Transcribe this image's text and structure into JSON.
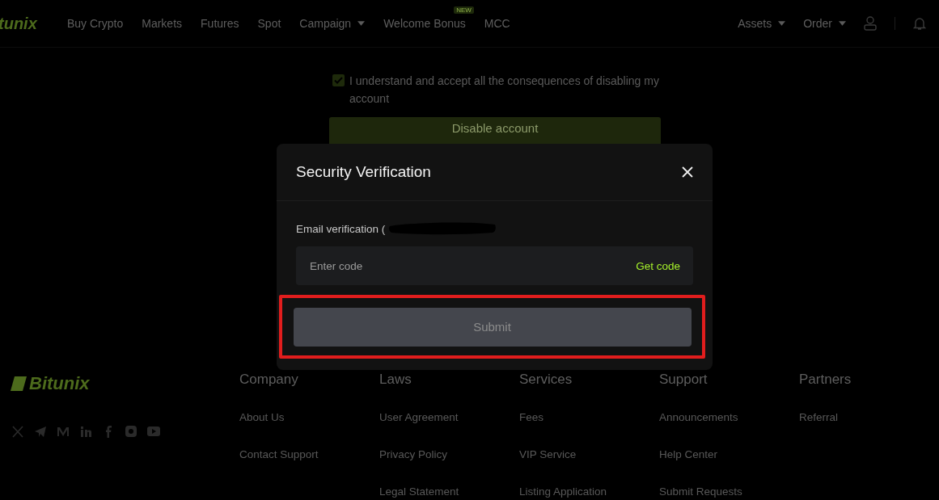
{
  "header": {
    "logo": "tunix",
    "nav": [
      {
        "label": "Buy Crypto",
        "dropdown": false
      },
      {
        "label": "Markets",
        "dropdown": false
      },
      {
        "label": "Futures",
        "dropdown": false
      },
      {
        "label": "Spot",
        "dropdown": false
      },
      {
        "label": "Campaign",
        "dropdown": true
      },
      {
        "label": "Welcome Bonus",
        "dropdown": false,
        "badge": "NEW"
      },
      {
        "label": "MCC",
        "dropdown": false
      }
    ],
    "right": [
      {
        "label": "Assets",
        "dropdown": true
      },
      {
        "label": "Order",
        "dropdown": true
      }
    ]
  },
  "page": {
    "consent": {
      "text": "I understand and accept all the consequences of disabling my account",
      "checked": true
    },
    "button": "Disable account"
  },
  "modal": {
    "title": "Security Verification",
    "field_label": "Email verification (",
    "input": {
      "placeholder": "Enter code"
    },
    "get_code": "Get code",
    "submit": {
      "label": "Submit",
      "disabled": true
    }
  },
  "footer": {
    "logo": "Bitunix",
    "columns": [
      {
        "title": "Company",
        "links": [
          "About Us",
          "Contact Support"
        ]
      },
      {
        "title": "Laws",
        "links": [
          "User Agreement",
          "Privacy Policy",
          "Legal Statement"
        ]
      },
      {
        "title": "Services",
        "links": [
          "Fees",
          "VIP Service",
          "Listing Application"
        ]
      },
      {
        "title": "Support",
        "links": [
          "Announcements",
          "Help Center",
          "Submit Requests"
        ]
      },
      {
        "title": "Partners",
        "links": [
          "Referral"
        ]
      }
    ]
  }
}
